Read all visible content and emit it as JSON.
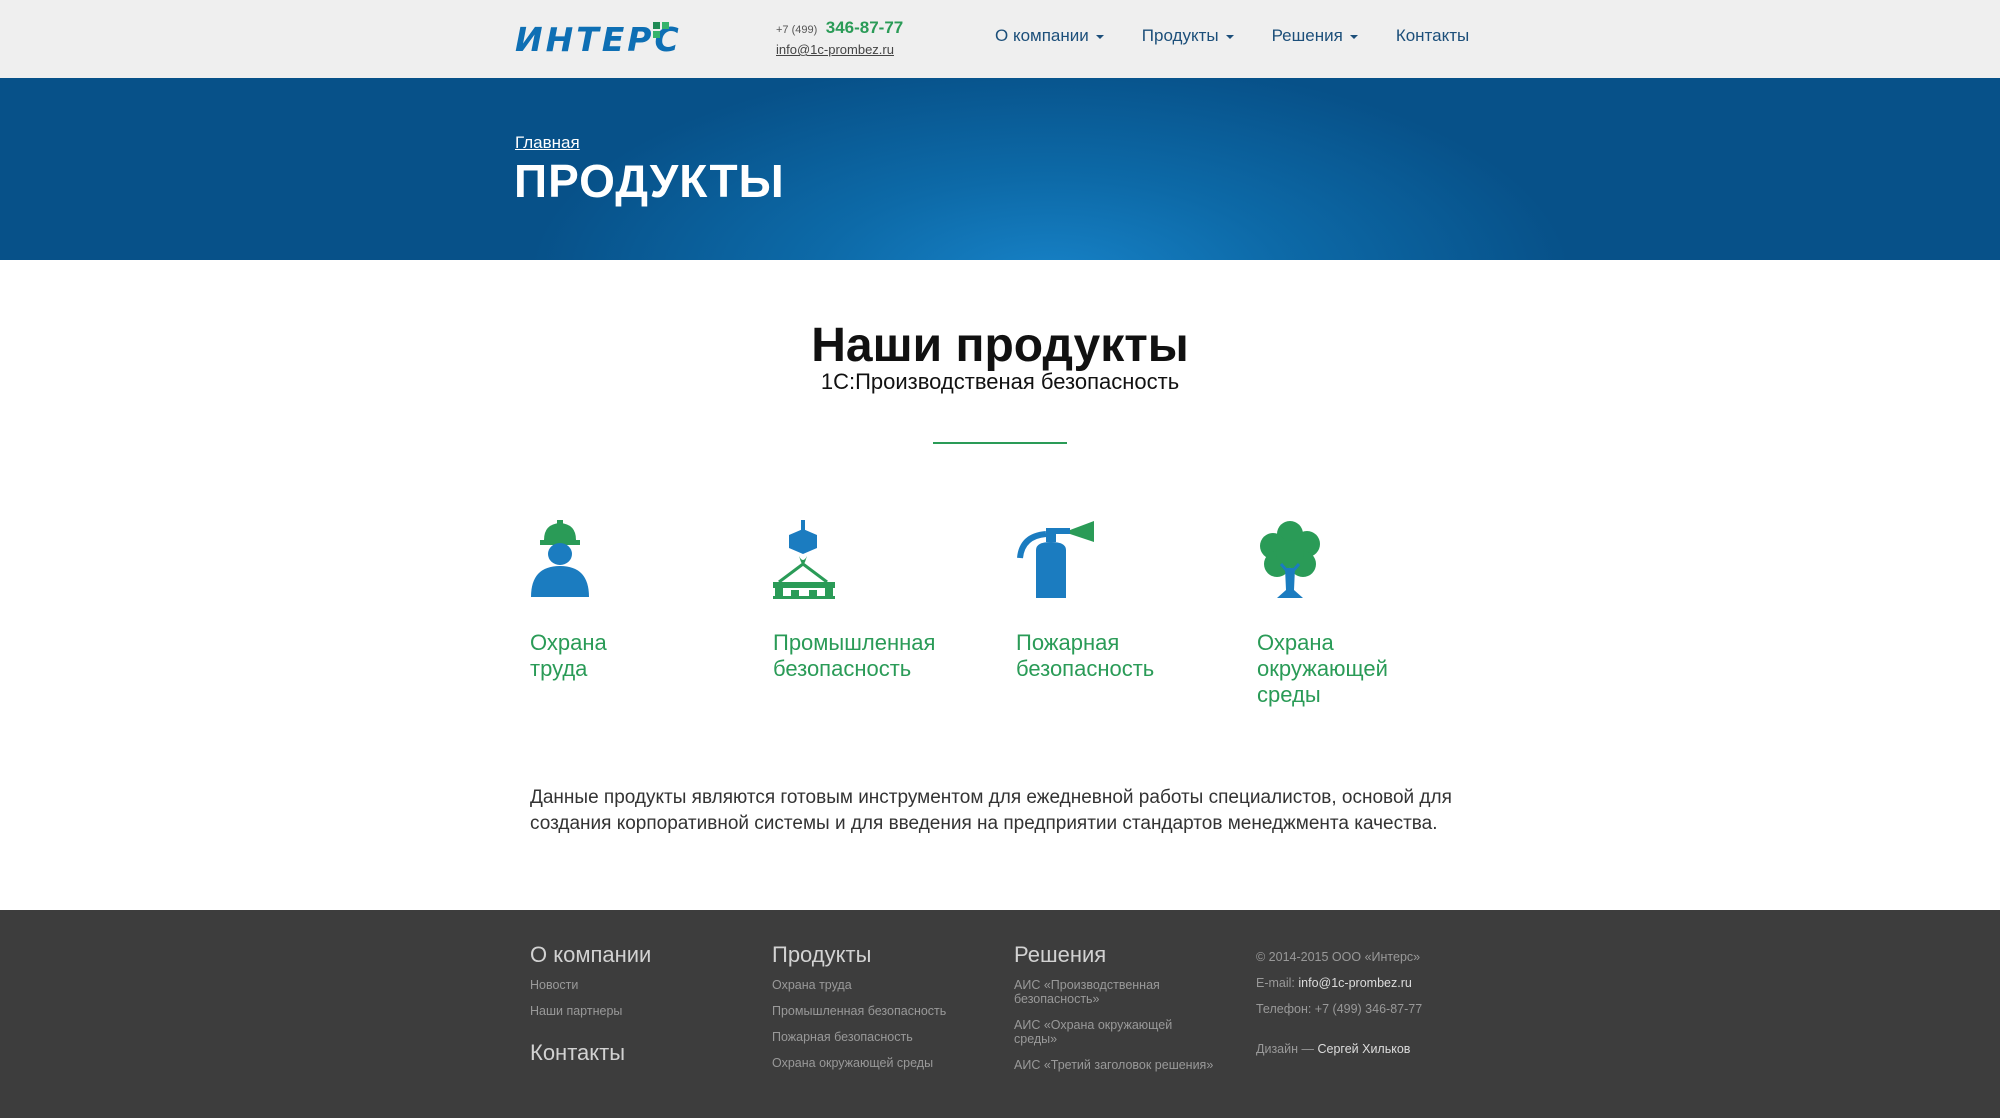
{
  "header": {
    "logo_text": "ИНТЕРС",
    "phone_prefix": "+7 (499)",
    "phone_main": "346-87-77",
    "email": "info@1c-prombez.ru",
    "nav": [
      "О компании",
      "Продукты",
      "Решения",
      "Контакты"
    ]
  },
  "hero": {
    "breadcrumb": "Главная",
    "title": "ПРОДУКТЫ"
  },
  "section": {
    "title": "Наши продукты",
    "subtitle": "1С:Производственая безопасность"
  },
  "products": [
    {
      "label": "Охрана\nтруда",
      "icon": "worker-helmet-icon"
    },
    {
      "label": "Промышленная\nбезопасность",
      "icon": "crane-hook-icon"
    },
    {
      "label": "Пожарная\nбезопасность",
      "icon": "fire-extinguisher-icon"
    },
    {
      "label": "Охрана\nокружающей\nсреды",
      "icon": "tree-icon"
    }
  ],
  "description": "Данные продукты являются готовым инструментом для ежедневной работы специалистов, основой для создания корпоративной системы и для введения на предприятии стандартов менеджмента качества.",
  "colors": {
    "accent_green": "#2a9b57",
    "brand_blue": "#0e6fb4",
    "footer_bg": "#3d3d3d"
  },
  "footer": {
    "company": {
      "title": "О компании",
      "links": [
        "Новости",
        "Наши партнеры"
      ],
      "contacts_title": "Контакты"
    },
    "products": {
      "title": "Продукты",
      "links": [
        "Охрана труда",
        "Промышленная безопасность",
        "Пожарная безопасность",
        "Охрана окружающей среды"
      ]
    },
    "solutions": {
      "title": "Решения",
      "links": [
        "АИС «Производственная безопасность»",
        "АИС «Охрана окружающей среды»",
        "АИС «Третий заголовок решения»"
      ]
    },
    "info": {
      "copyright": "© 2014-2015 ООО «Интерс»",
      "email_label": "E-mail:",
      "email": "info@1c-prombez.ru",
      "phone": "Телефон: +7 (499) 346-87-77",
      "design_label": "Дизайн —",
      "designer": "Сергей Хильков"
    }
  }
}
